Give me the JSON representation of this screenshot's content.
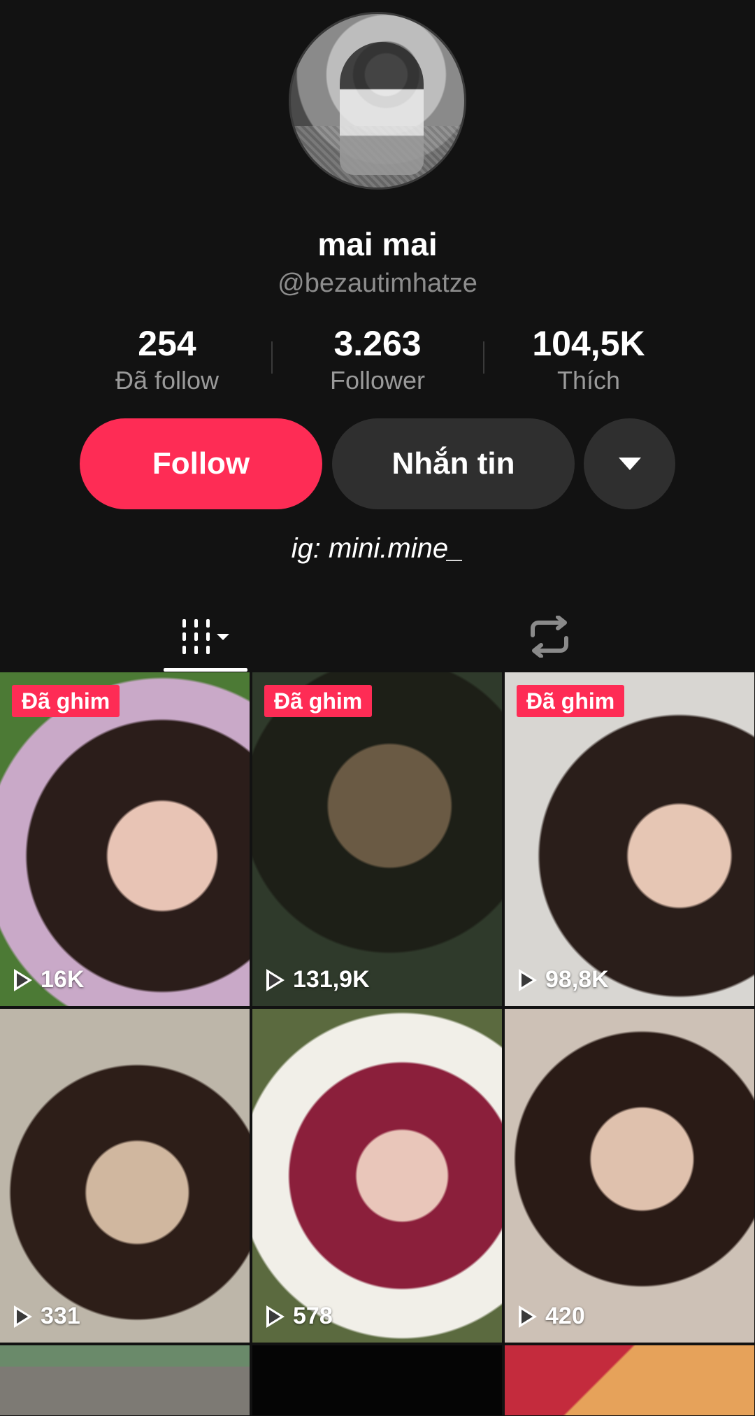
{
  "profile": {
    "display_name": "mai mai",
    "username": "@bezautimhatze",
    "bio": "ig: mini.mine_"
  },
  "stats": [
    {
      "value": "254",
      "label": "Đã follow"
    },
    {
      "value": "3.263",
      "label": "Follower"
    },
    {
      "value": "104,5K",
      "label": "Thích"
    }
  ],
  "actions": {
    "follow_label": "Follow",
    "message_label": "Nhắn tin"
  },
  "tabs": {
    "videos_icon": "grid-icon",
    "repost_icon": "repost-icon"
  },
  "videos": [
    {
      "pinned_label": "Đã ghim",
      "views": "16K"
    },
    {
      "pinned_label": "Đã ghim",
      "views": "131,9K"
    },
    {
      "pinned_label": "Đã ghim",
      "views": "98,8K"
    },
    {
      "views": "331"
    },
    {
      "views": "578"
    },
    {
      "views": "420"
    }
  ],
  "colors": {
    "accent": "#fe2c55",
    "background": "#121212",
    "secondary_button": "#2f2f2f"
  }
}
